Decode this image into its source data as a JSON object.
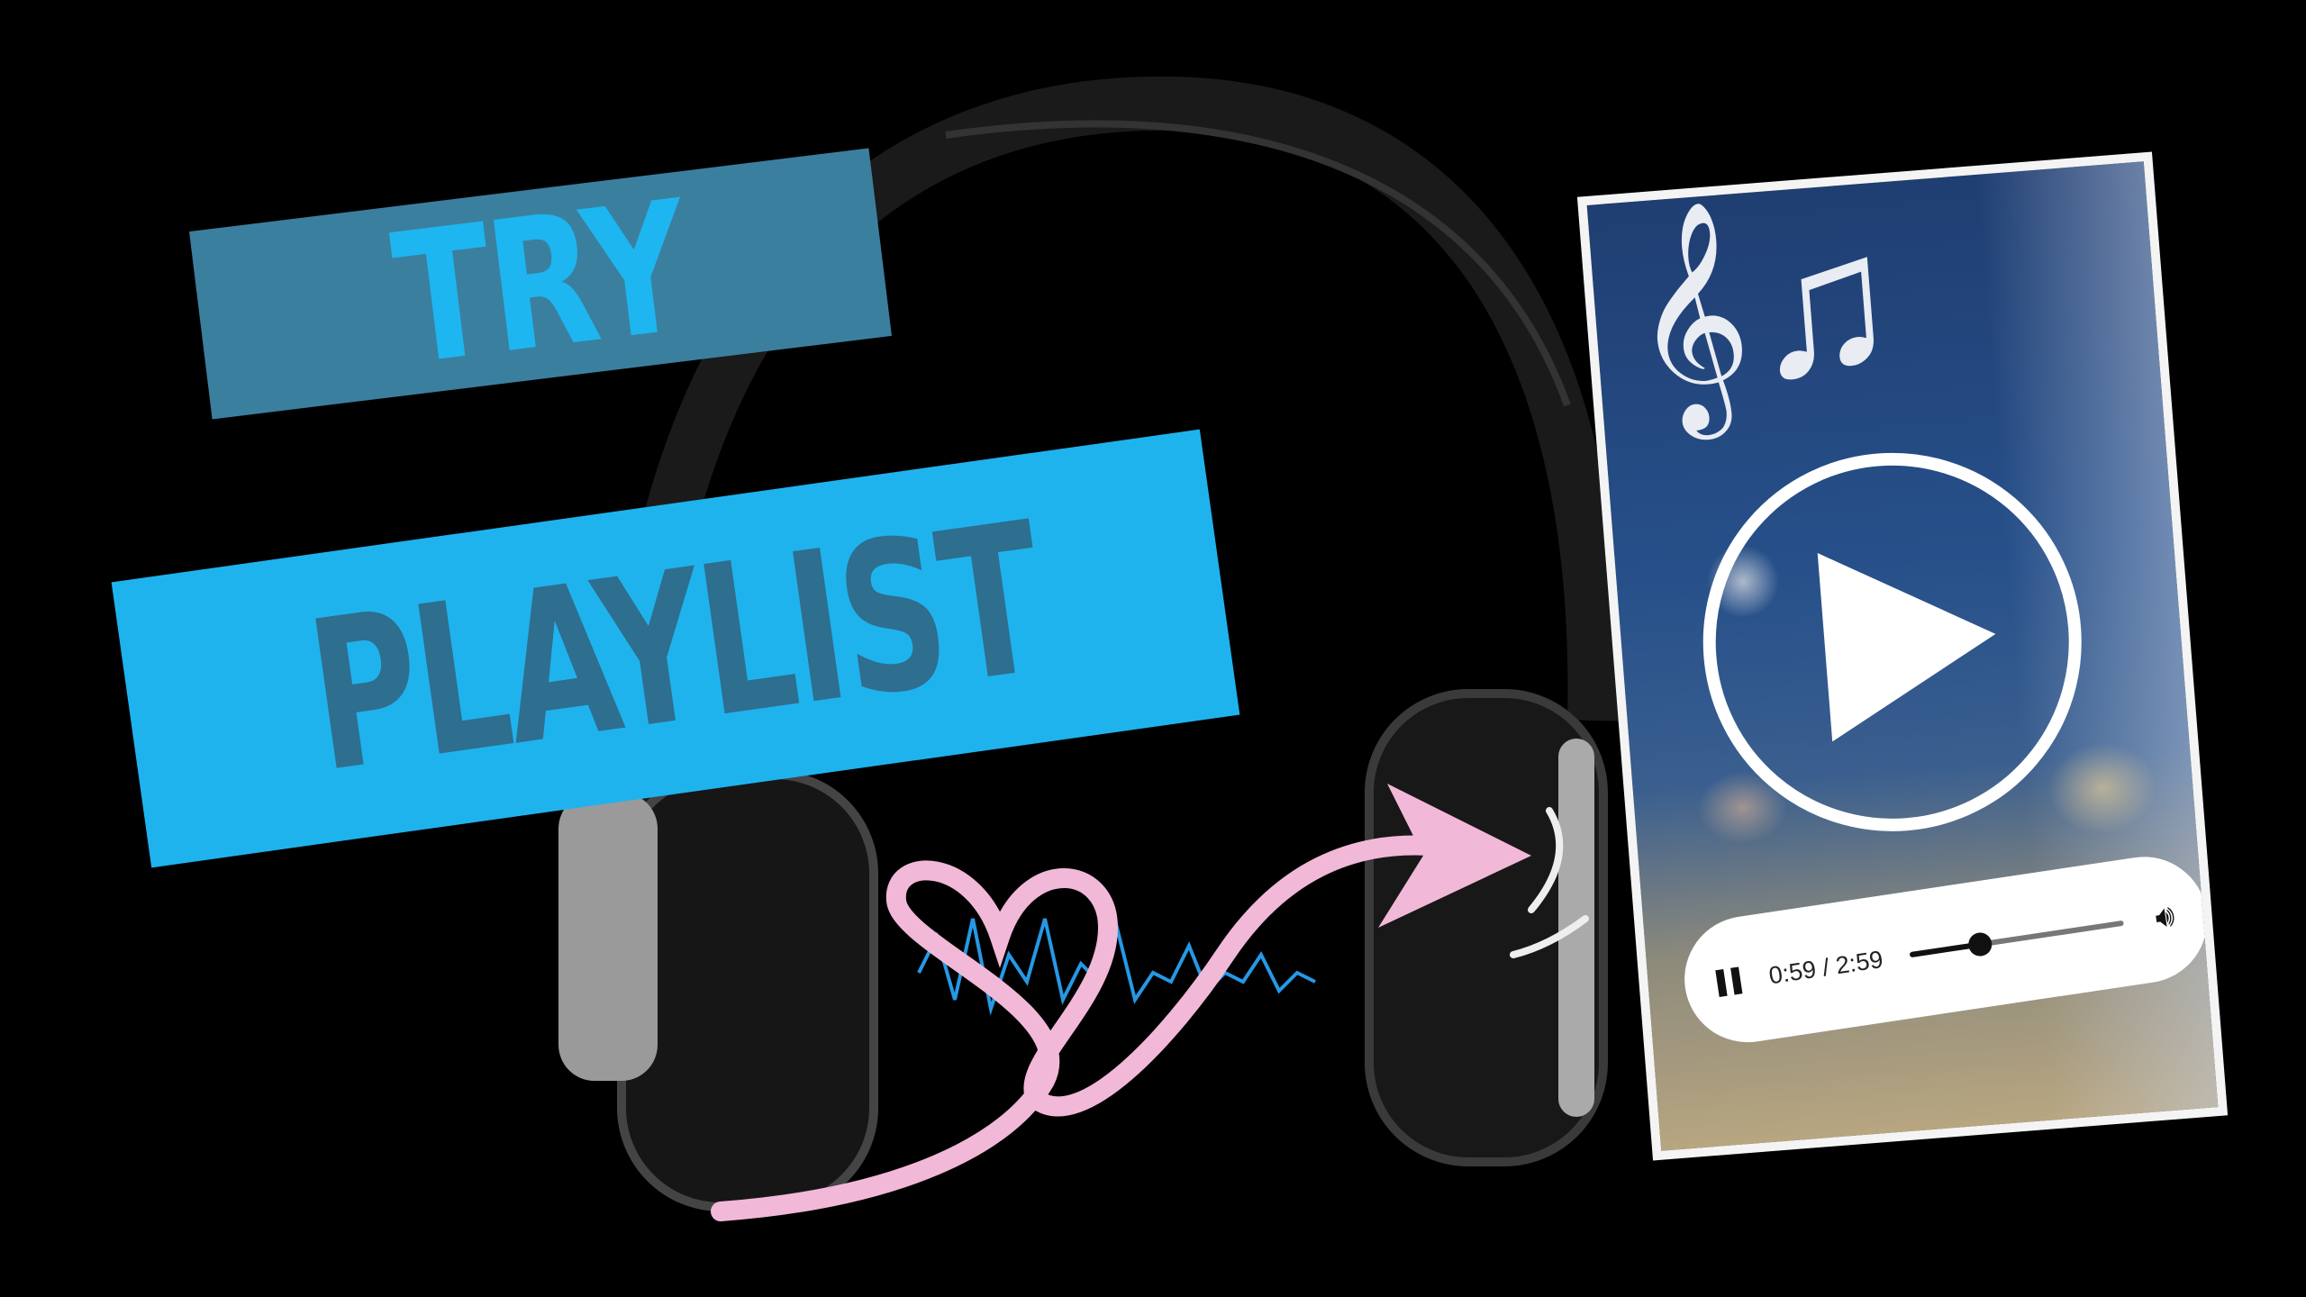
{
  "banners": {
    "top": "TRY",
    "bottom": "PLAYLIST"
  },
  "player": {
    "current_time": "0:59",
    "duration": "2:59",
    "time_display": "0:59 / 2:59",
    "progress_fraction": 0.33,
    "icons": {
      "pause": "pause-icon",
      "volume": "volume-icon",
      "play": "play-icon"
    }
  },
  "colors": {
    "try_bg": "#3b7f9f",
    "playlist_bg": "#1fb3ee",
    "heart_arrow": "#f2b8d8"
  }
}
